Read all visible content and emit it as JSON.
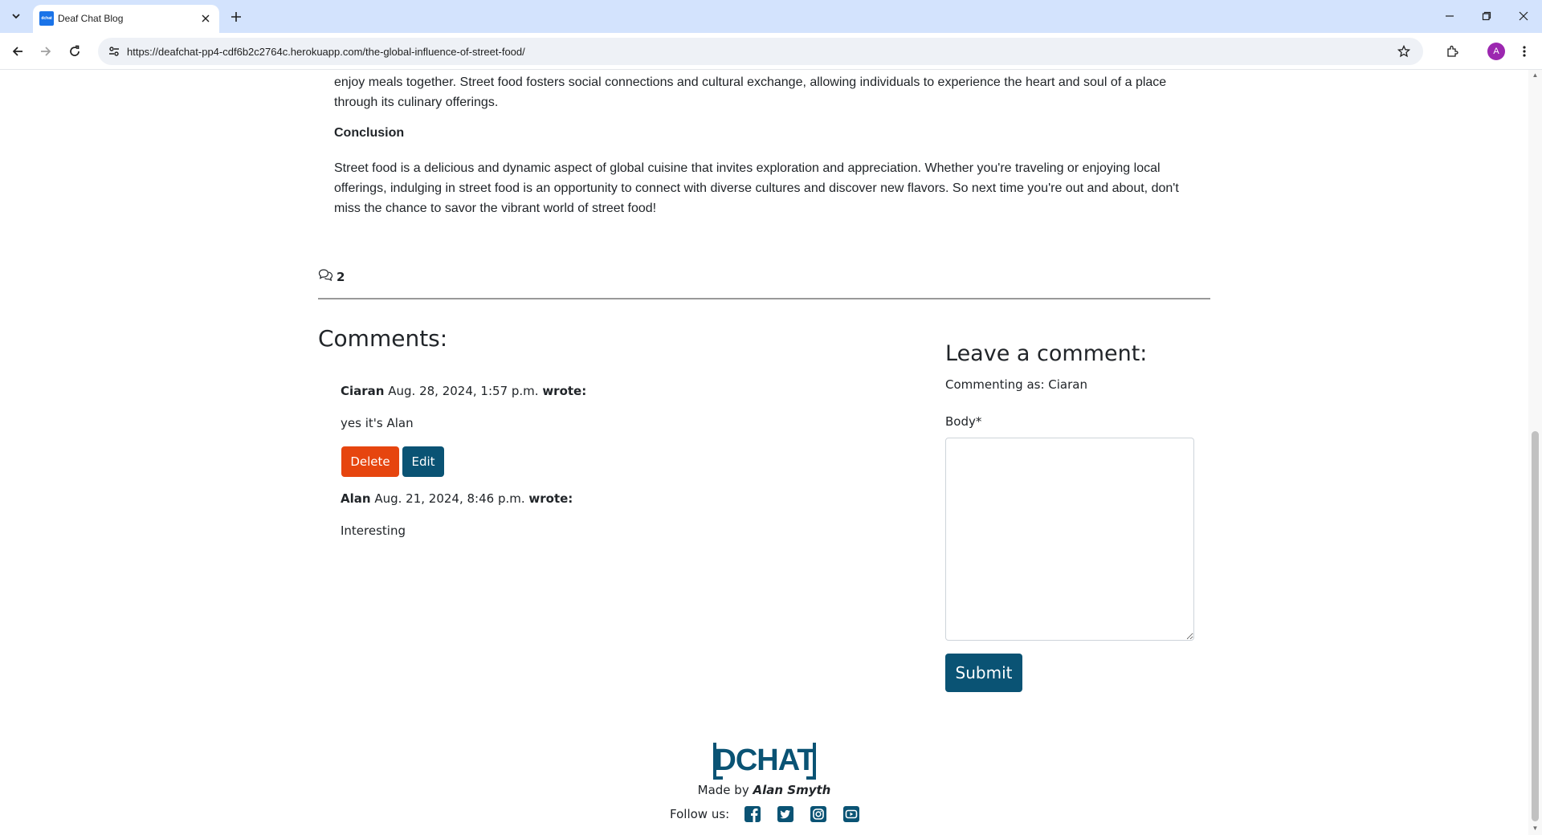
{
  "browser": {
    "tab_title": "Deaf Chat Blog",
    "favicon_text": "dchat",
    "url": "https://deafchat-pp4-cdf6b2c2764c.herokuapp.com/the-global-influence-of-street-food/",
    "profile_initial": "A",
    "icons": [
      "tab-list-icon",
      "close-icon",
      "plus-icon",
      "minimize-icon",
      "restore-icon",
      "close-window-icon",
      "back-icon",
      "forward-icon",
      "reload-icon",
      "site-info-icon",
      "star-icon",
      "extensions-icon",
      "more-icon"
    ]
  },
  "article": {
    "paragraph_end": "enjoy meals together. Street food fosters social connections and cultural exchange, allowing individuals to experience the heart and soul of a place through its culinary offerings.",
    "conclusion_heading": "Conclusion",
    "conclusion_text": "Street food is a delicious and dynamic aspect of global cuisine that invites exploration and appreciation. Whether you're traveling or enjoying local offerings, indulging in street food is an opportunity to connect with diverse cultures and discover new flavors. So next time you're out and about, don't miss the chance to savor the vibrant world of street food!"
  },
  "comment_count": "2",
  "comments_section": {
    "title": "Comments:",
    "wrote_label": "wrote:",
    "comments": [
      {
        "author": "Ciaran",
        "date": "Aug. 28, 2024, 1:57 p.m.",
        "body": "yes it's Alan"
      },
      {
        "author": "Alan",
        "date": "Aug. 21, 2024, 8:46 p.m.",
        "body": "Interesting"
      }
    ],
    "delete_label": "Delete",
    "edit_label": "Edit"
  },
  "comment_form": {
    "title": "Leave a comment:",
    "commenting_as": "Commenting as: Ciaran",
    "body_label": "Body*",
    "body_value": "",
    "submit_label": "Submit"
  },
  "footer": {
    "logo_text": "DCHAT",
    "made_by_prefix": "Made by",
    "made_by_name": "Alan Smyth",
    "follow_label": "Follow us:",
    "social_icons": [
      "facebook-icon",
      "twitter-icon",
      "instagram-icon",
      "youtube-icon"
    ]
  },
  "colors": {
    "delete": "#e6450f",
    "primary": "#0a5374",
    "tab_strip": "#d3e3fd"
  }
}
